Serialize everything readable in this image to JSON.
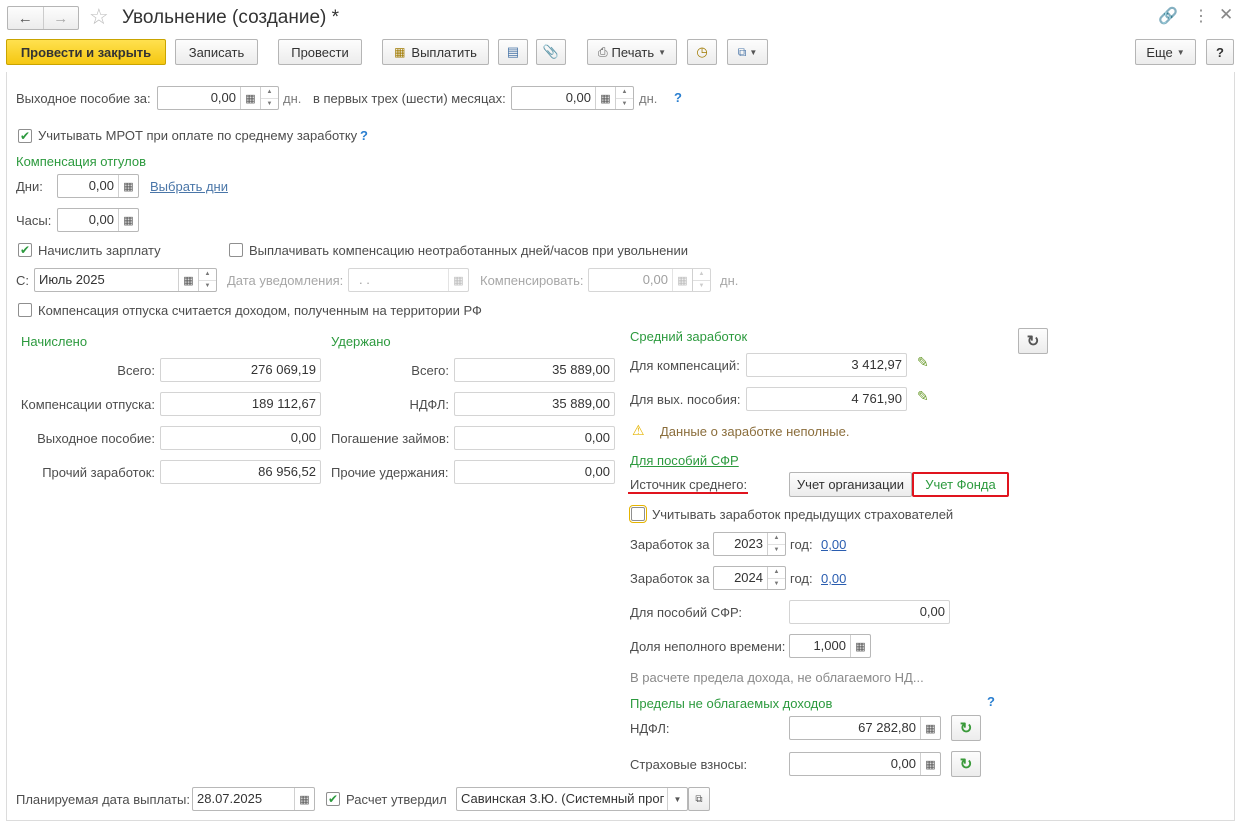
{
  "window": {
    "title": "Увольнение (создание) *",
    "back_icon": "arrow-left-icon",
    "forward_icon": "arrow-right-icon",
    "favorite_icon": "star-icon"
  },
  "toolbar": {
    "post_close": "Провести и закрыть",
    "save": "Записать",
    "post": "Провести",
    "pay": "Выплатить",
    "print": "Печать",
    "more": "Еще",
    "help": "?"
  },
  "severance": {
    "label": "Выходное пособие за:",
    "value": "0,00",
    "unit": "дн.",
    "first_months_label": "в первых трех (шести) месяцах:",
    "first_months_value": "0,00",
    "first_months_unit": "дн.",
    "help": "?"
  },
  "mrot": {
    "label": "Учитывать МРОТ при оплате по среднему заработку",
    "checked": true,
    "help": "?"
  },
  "timeoff": {
    "group_title": "Компенсация отгулов",
    "days_label": "Дни:",
    "days_value": "0,00",
    "pick_days": "Выбрать дни",
    "hours_label": "Часы:",
    "hours_value": "0,00"
  },
  "salary": {
    "accrue_label": "Начислить зарплату",
    "accrue_checked": true,
    "pay_comp_label": "Выплачивать компенсацию неотработанных дней/часов при увольнении",
    "pay_comp_checked": false,
    "from_label": "С:",
    "from_value": "Июль 2025",
    "notice_label": "Дата уведомления:",
    "notice_value": ". .",
    "compensate_label": "Компенсировать:",
    "compensate_value": "0,00",
    "compensate_unit": "дн."
  },
  "vacation_rf": {
    "label": "Компенсация отпуска считается доходом, полученным на территории РФ",
    "checked": false
  },
  "accrued": {
    "title": "Начислено",
    "rows": [
      {
        "label": "Всего:",
        "value": "276 069,19"
      },
      {
        "label": "Компенсации отпуска:",
        "value": "189 112,67"
      },
      {
        "label": "Выходное пособие:",
        "value": "0,00"
      },
      {
        "label": "Прочий заработок:",
        "value": "86 956,52"
      }
    ]
  },
  "withheld": {
    "title": "Удержано",
    "rows": [
      {
        "label": "Всего:",
        "value": "35 889,00"
      },
      {
        "label": "НДФЛ:",
        "value": "35 889,00"
      },
      {
        "label": "Погашение займов:",
        "value": "0,00"
      },
      {
        "label": "Прочие удержания:",
        "value": "0,00"
      }
    ]
  },
  "average": {
    "title": "Средний заработок",
    "comp_label": "Для компенсаций:",
    "comp_value": "3 412,97",
    "sev_label": "Для вых. пособия:",
    "sev_value": "4 761,90",
    "warning": "Данные о заработке неполные.",
    "sfr_link": "Для пособий СФР",
    "source_label": "Источник среднего:",
    "source_org": "Учет организации",
    "source_fund": "Учет Фонда",
    "prev_insurers_label": "Учитывать заработок предыдущих страхователей",
    "prev_insurers_checked": false,
    "earn_label": "Заработок за",
    "earn_year1": "2023",
    "earn_year2": "2024",
    "year_word": "год:",
    "earn_value1": "0,00",
    "earn_value2": "0,00",
    "sfr_label": "Для пособий СФР:",
    "sfr_value": "0,00",
    "parttime_label": "Доля неполного времени:",
    "parttime_value": "1,000",
    "limit_note": "В расчете предела дохода, не облагаемого НД..."
  },
  "limits": {
    "title": "Пределы не облагаемых доходов",
    "help": "?",
    "ndfl_label": "НДФЛ:",
    "ndfl_value": "67 282,80",
    "ins_label": "Страховые взносы:",
    "ins_value": "0,00"
  },
  "footer": {
    "pay_date_label": "Планируемая дата выплаты:",
    "pay_date_value": "28.07.2025",
    "approved_label": "Расчет утвердил",
    "approved_checked": true,
    "approver": "Савинская З.Ю. (Системный прог"
  },
  "colors": {
    "accent_green": "#2c9a3e",
    "primary_yellow": "#f5c711",
    "highlight_red": "#e0141e"
  }
}
